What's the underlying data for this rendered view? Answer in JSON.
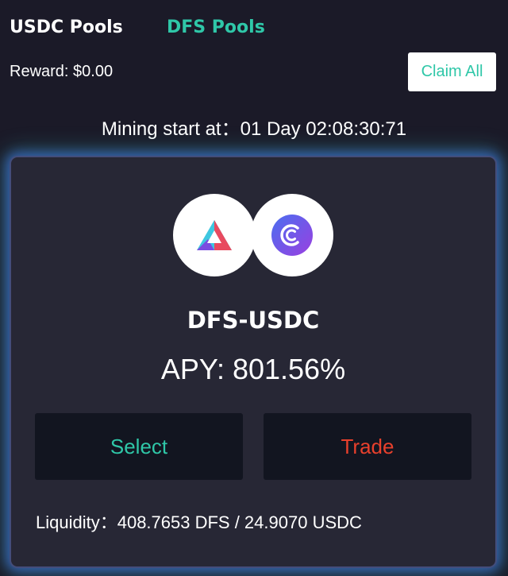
{
  "tabs": [
    {
      "label": "USDC Pools"
    },
    {
      "label": "DFS Pools"
    }
  ],
  "reward": {
    "text": "Reward: $0.00"
  },
  "claim_all": {
    "label": "Claim All"
  },
  "mining": {
    "text": "Mining start at：01 Day 02:08:30:71"
  },
  "pool": {
    "pair": "DFS-USDC",
    "apy": "APY: 801.56%",
    "select_label": "Select",
    "trade_label": "Trade",
    "liquidity": "Liquidity：408.7653 DFS / 24.9070 USDC",
    "token_icons": [
      "dfs-token-icon",
      "usdc-token-icon"
    ]
  },
  "colors": {
    "accent": "#2fc7a8",
    "trade": "#e8402c",
    "background": "#1b1a28",
    "card": "#272735",
    "button": "#121520"
  }
}
